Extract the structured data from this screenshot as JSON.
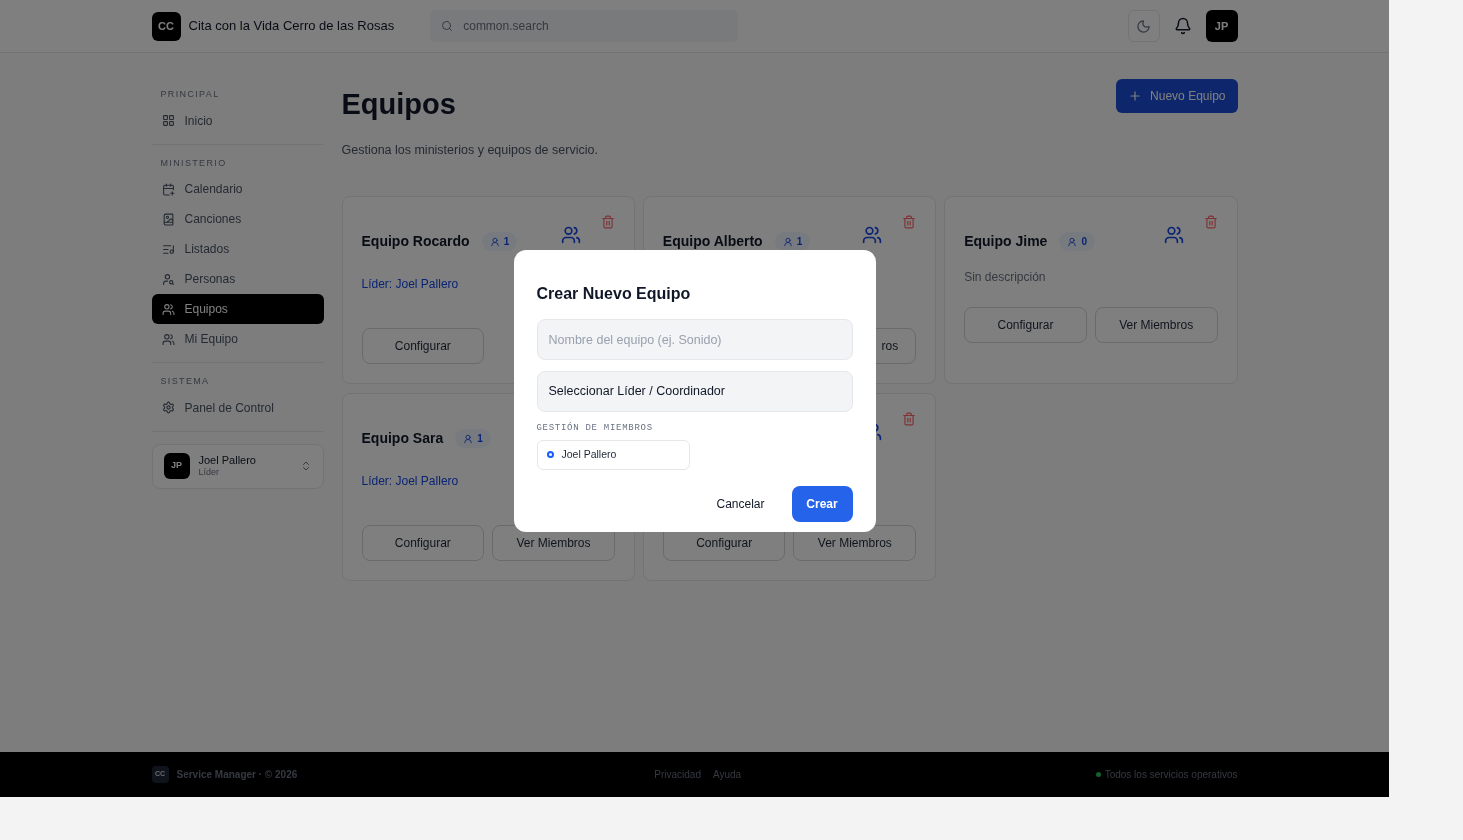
{
  "header": {
    "logo": "CC",
    "title": "Cita con la Vida Cerro de las Rosas",
    "search": {
      "placeholder": "common.search"
    },
    "avatar": "JP"
  },
  "sidebar": {
    "sections": [
      {
        "label": "PRINCIPAL",
        "items": [
          {
            "label": "Inicio",
            "selected": false
          }
        ]
      },
      {
        "label": "MINISTERIO",
        "items": [
          {
            "label": "Calendario",
            "selected": false
          },
          {
            "label": "Canciones",
            "selected": false
          },
          {
            "label": "Listados",
            "selected": false
          },
          {
            "label": "Personas",
            "selected": false
          },
          {
            "label": "Equipos",
            "selected": true
          },
          {
            "label": "Mi Equipo",
            "selected": false
          }
        ]
      },
      {
        "label": "SISTEMA",
        "items": [
          {
            "label": "Panel de Control",
            "selected": false
          }
        ]
      }
    ],
    "user": {
      "avatar": "JP",
      "name": "Joel Pallero",
      "role": "Líder"
    }
  },
  "page": {
    "title": "Equipos",
    "subtitle": "Gestiona los ministerios y equipos de servicio.",
    "new_button": "Nuevo Equipo"
  },
  "cards": [
    {
      "kind": "leader",
      "title": "Equipo Rocardo",
      "count": "1",
      "leader": "Líder: Joel Pallero",
      "buttons": [
        {
          "label": "Configurar",
          "kind": "left"
        }
      ]
    },
    {
      "kind": "leader",
      "title": "Equipo Alberto",
      "count": "1",
      "buttons": [
        {
          "label": "ros",
          "kind": "cut"
        }
      ]
    },
    {
      "kind": "description",
      "title": "Equipo Jime",
      "count": "0",
      "description": "Sin descripción",
      "buttons": [
        {
          "label": "Configurar",
          "kind": "left"
        },
        {
          "label": "Ver Miembros",
          "kind": "right"
        }
      ]
    },
    {
      "kind": "covered",
      "title": "Equipo Sara",
      "count": "1",
      "leader": "Líder: Joel Pallero",
      "buttons": [
        {
          "label": "Configurar",
          "kind": "left"
        },
        {
          "label": "Ver Miembros",
          "kind": "right"
        }
      ]
    },
    {
      "kind": "leader",
      "buttons": [
        {
          "label": "Configurar",
          "kind": "left"
        },
        {
          "label": "Ver Miembros",
          "kind": "right"
        }
      ]
    }
  ],
  "modal": {
    "title": "Crear Nuevo Equipo",
    "name_field": {
      "placeholder": "Nombre del equipo (ej. Sonido)"
    },
    "leader_select": {
      "value": "Seleccionar Líder / Coordinador"
    },
    "members_label": "GESTIÓN DE MIEMBROS",
    "members": [
      {
        "name": "Joel Pallero"
      }
    ],
    "cancel": "Cancelar",
    "submit": "Crear"
  },
  "footer": {
    "logo": "CC",
    "brand": "Service Manager · © 2026",
    "links": [
      "Privacidad",
      "Ayuda"
    ],
    "status": "Todos los servicios operativos"
  }
}
